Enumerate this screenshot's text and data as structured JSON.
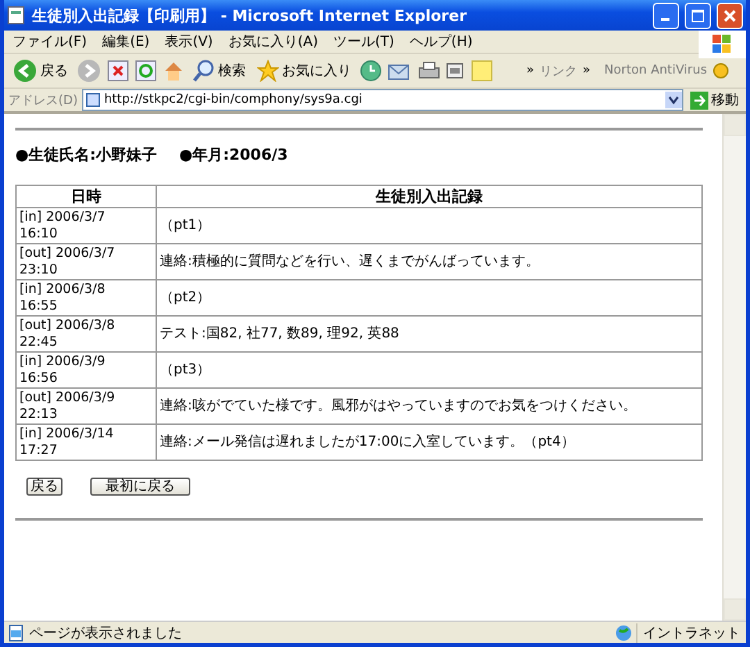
{
  "window": {
    "title": "生徒別入出記録【印刷用】 - Microsoft Internet Explorer"
  },
  "menu_bar": [
    "ファイル(F)",
    "編集(E)",
    "表示(V)",
    "お気に入り(A)",
    "ツール(T)",
    "ヘルプ(H)"
  ],
  "toolbar": {
    "back": "戻る",
    "search": "検索",
    "favorites": "お気に入り",
    "more": "»",
    "links": "リンク",
    "more_links": "»",
    "norton": "Norton AntiVirus"
  },
  "address_bar": {
    "label": "アドレス(D)",
    "url": "http://stkpc2/cgi-bin/comphony/sys9a.cgi",
    "go": "移動"
  },
  "page": {
    "student_label": "●生徒氏名:小野妹子",
    "month_label": "●年月:2006/3",
    "table": {
      "columns": [
        "日時",
        "生徒別入出記録"
      ],
      "rows": [
        {
          "date_line1": "[in] 2006/3/7",
          "date_line2": "16:10",
          "record": "（pt1）"
        },
        {
          "date_line1": "[out] 2006/3/7",
          "date_line2": "23:10",
          "record": "連絡:積極的に質問などを行い、遅くまでがんばっています。"
        },
        {
          "date_line1": "[in] 2006/3/8",
          "date_line2": "16:55",
          "record": "（pt2）"
        },
        {
          "date_line1": "[out] 2006/3/8",
          "date_line2": "22:45",
          "record": "テスト:国82, 社77, 数89, 理92, 英88"
        },
        {
          "date_line1": "[in] 2006/3/9",
          "date_line2": "16:56",
          "record": "（pt3）"
        },
        {
          "date_line1": "[out] 2006/3/9",
          "date_line2": "22:13",
          "record": "連絡:咳がでていた様です。風邪がはやっていますのでお気をつけください。"
        },
        {
          "date_line1": "[in] 2006/3/14",
          "date_line2": "17:27",
          "record": "連絡:メール発信は遅れましたが17:00に入室しています。（pt4）"
        }
      ]
    },
    "buttons": [
      "戻る",
      "最初に戻る"
    ]
  },
  "status_bar": {
    "message": "ページが表示されました",
    "zone": "イントラネット"
  }
}
